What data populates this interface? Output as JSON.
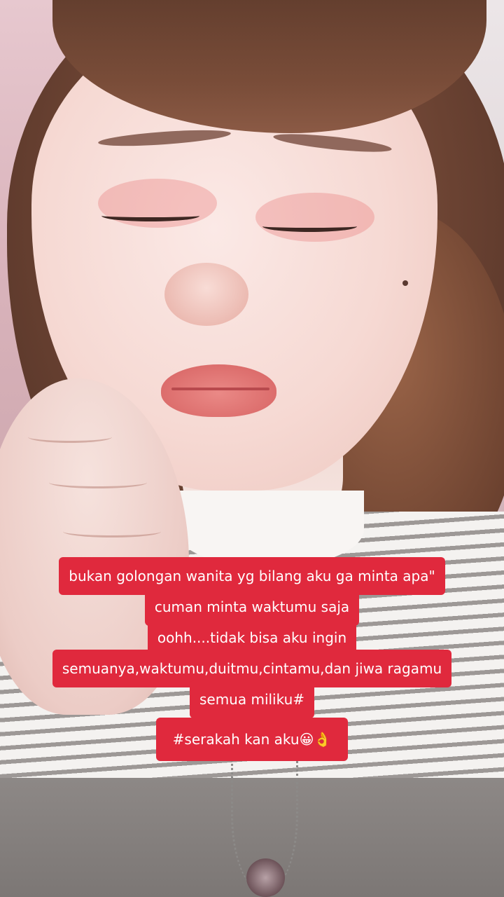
{
  "caption": {
    "lines": [
      "bukan golongan wanita yg bilang aku ga minta apa\"",
      "cuman minta waktumu saja",
      "oohh....tidak bisa aku ingin",
      "semuanya,waktumu,duitmu,cintamu,dan jiwa ragamu",
      "semua miliku#"
    ],
    "hashtag": "#serakah kan aku😀👌"
  },
  "colors": {
    "caption_background": "#e0293d",
    "caption_text": "#ffffff"
  }
}
